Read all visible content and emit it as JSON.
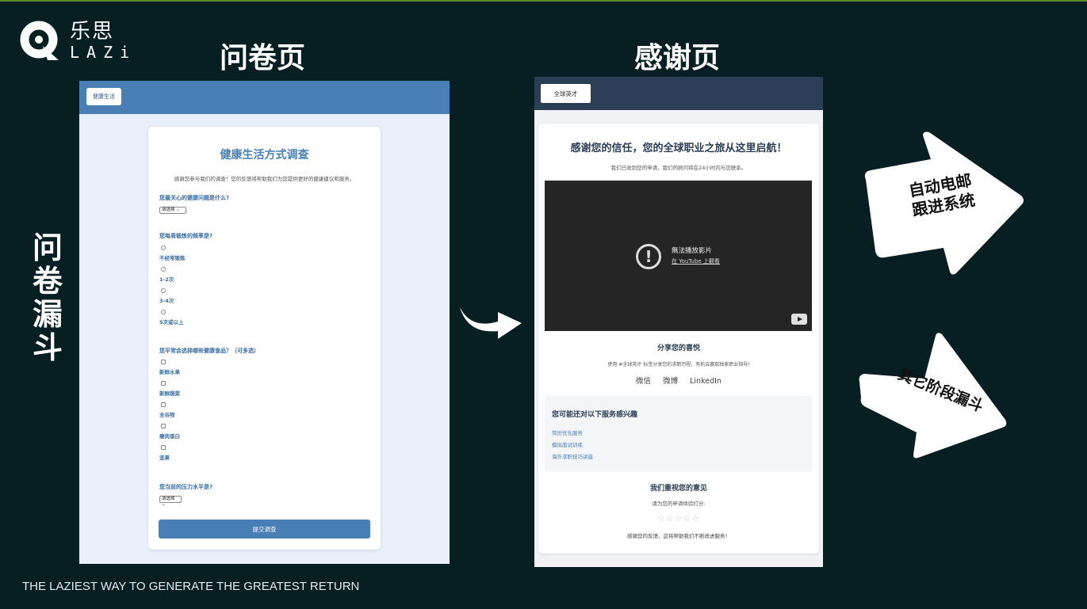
{
  "brand": {
    "name_cn": "乐思",
    "name_en": "LAZi"
  },
  "titles": {
    "survey": "问卷页",
    "thanks": "感谢页",
    "vertical": "问卷漏斗"
  },
  "slogan": "THE LAZIEST WAY TO GENERATE THE GREATEST RETURN",
  "survey": {
    "header_button": "健康生活",
    "title": "健康生活方式调查",
    "intro": "感谢您参与我们的调查！您的反馈将帮助我们为您提供更好的健康建议和服务。",
    "q1": {
      "label": "您最关心的健康问题是什么?",
      "select": "请选择"
    },
    "q2": {
      "label": "您每周锻炼的频率是?",
      "options": [
        "不经常锻炼",
        "1-2次",
        "3-4次",
        "5次或以上"
      ]
    },
    "q3": {
      "label": "您平常会选择哪些健康食品？（可多选）",
      "options": [
        "新鲜水果",
        "新鲜蔬菜",
        "全谷物",
        "瘦肉蛋白",
        "坚果"
      ]
    },
    "q4": {
      "label": "您当前的压力水平是?",
      "select": "请选择"
    },
    "submit": "提交调查"
  },
  "thanks": {
    "header_button": "全球英才",
    "title": "感谢您的信任，您的全球职业之旅从这里启航！",
    "subtitle": "我们已收到您的申请，我们的顾问将在24小时内与您联系。",
    "video": {
      "message": "無法播放影片",
      "link": "在 YouTube 上觀看"
    },
    "share": {
      "heading": "分享您的喜悦",
      "text": "使用 #全球英才 标签分享您的求职历程，有机会赢取独家职业指导!",
      "links": [
        "微信",
        "微博",
        "LinkedIn"
      ]
    },
    "services": {
      "heading": "您可能还对以下服务感兴趣",
      "links": [
        "简历优化服务",
        "模拟面试训练",
        "海外求职技巧讲座"
      ]
    },
    "feedback": {
      "heading": "我们重视您的意见",
      "prompt": "请为您的申请体验打分:",
      "stars": "☆☆☆☆☆",
      "thanks": "感谢您的反馈，这将帮助我们不断改进服务！"
    }
  },
  "arrows": {
    "email": "自动电邮\n跟进系统",
    "other": "其它阶段漏斗"
  },
  "colors": {
    "background": "#071e23",
    "survey_blue": "#4a7fb5",
    "thanks_navy": "#2c3e55"
  }
}
